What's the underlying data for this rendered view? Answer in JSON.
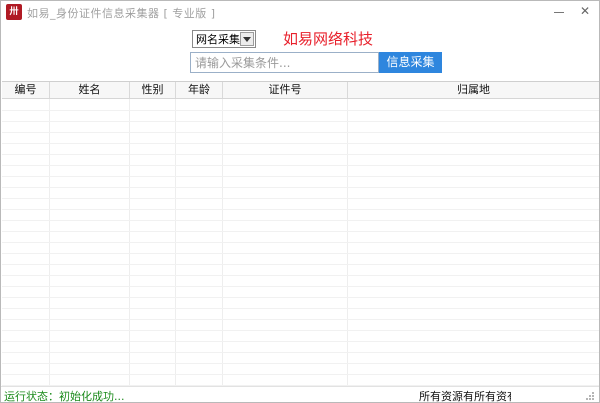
{
  "window": {
    "icon_glyph": "卅",
    "title": "如易_身份证件信息采集器 [ 专业版 ]",
    "minimize_label": "—",
    "close_label": "✕"
  },
  "toolbar": {
    "mode_select_value": "网名采集",
    "brand_text": "如易网络科技",
    "search_placeholder": "请输入采集条件...",
    "search_button_label": "信息采集"
  },
  "grid": {
    "columns": [
      "编号",
      "姓名",
      "性别",
      "年龄",
      "证件号",
      "归属地"
    ]
  },
  "statusbar": {
    "status_text": "运行状态：初始化成功...",
    "copyright_text": "所有资源有所有资有"
  },
  "colors": {
    "accent_button": "#2e86de",
    "brand_red": "#e8202b",
    "status_green": "#1a8a1a",
    "app_icon": "#b01a24"
  },
  "icons": {
    "dropdown": "chevron-down-icon",
    "app": "app-icon",
    "grip": "resize-grip-icon"
  }
}
